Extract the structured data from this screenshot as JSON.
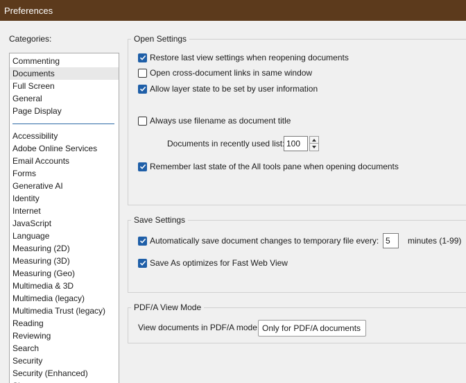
{
  "window": {
    "title": "Preferences"
  },
  "categories": {
    "label": "Categories:",
    "group1": [
      "Commenting",
      "Documents",
      "Full Screen",
      "General",
      "Page Display"
    ],
    "group2": [
      "Accessibility",
      "Adobe Online Services",
      "Email Accounts",
      "Forms",
      "Generative AI",
      "Identity",
      "Internet",
      "JavaScript",
      "Language",
      "Measuring (2D)",
      "Measuring (3D)",
      "Measuring (Geo)",
      "Multimedia & 3D",
      "Multimedia (legacy)",
      "Multimedia Trust (legacy)",
      "Reading",
      "Reviewing",
      "Search",
      "Security",
      "Security (Enhanced)",
      "Signatures"
    ],
    "selected": "Documents"
  },
  "open_settings": {
    "title": "Open Settings",
    "restore_last_view": {
      "label": "Restore last view settings when reopening documents",
      "checked": true
    },
    "open_cross_doc_links": {
      "label": "Open cross-document links in same window",
      "checked": false
    },
    "allow_layer_state": {
      "label": "Allow layer state to be set by user information",
      "checked": true
    },
    "use_filename_title": {
      "label": "Always use filename as document title",
      "checked": false
    },
    "recent_list_label": "Documents in recently used list:",
    "recent_list_value": "100",
    "remember_tools_pane": {
      "label": "Remember last state of the All tools pane when opening documents",
      "checked": true
    }
  },
  "save_settings": {
    "title": "Save Settings",
    "autosave": {
      "label": "Automatically save document changes to temporary file every:",
      "checked": true
    },
    "autosave_minutes": "5",
    "minutes_suffix": "minutes (1-99)",
    "fast_web_view": {
      "label": "Save As optimizes for Fast Web View",
      "checked": true
    }
  },
  "pdfa": {
    "title": "PDF/A View Mode",
    "view_label": "View documents in PDF/A mode:",
    "view_value": "Only for PDF/A documents"
  },
  "icons": {
    "checkmark": "checkmark-icon",
    "spin_up": "caret-up-icon",
    "spin_down": "caret-down-icon",
    "dropdown": "chevron-down-icon"
  },
  "colors": {
    "titlebar": "#5c3a1c",
    "checkbox": "#1f5fa8",
    "separator": "#2d6aa6",
    "background": "#f0f0f0"
  }
}
